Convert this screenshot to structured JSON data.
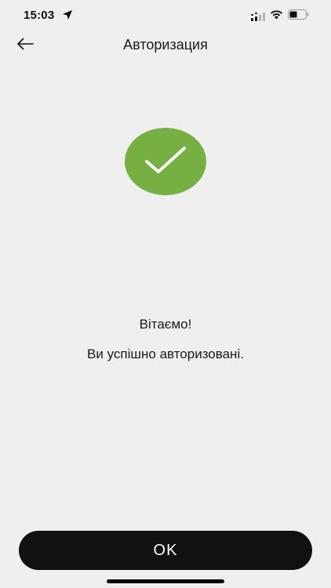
{
  "status_bar": {
    "time": "15:03",
    "icons": [
      "location-arrow-icon",
      "signal-icon",
      "wifi-icon",
      "battery-icon"
    ]
  },
  "nav": {
    "back_icon": "arrow-left-icon",
    "title": "Авторизация"
  },
  "success": {
    "icon": "checkmark-icon",
    "color": "#76b043"
  },
  "content": {
    "greeting": "Вітаємо!",
    "message": "Ви успішно авторизовані."
  },
  "actions": {
    "ok_label": "OK",
    "ok_color": "#111111"
  }
}
